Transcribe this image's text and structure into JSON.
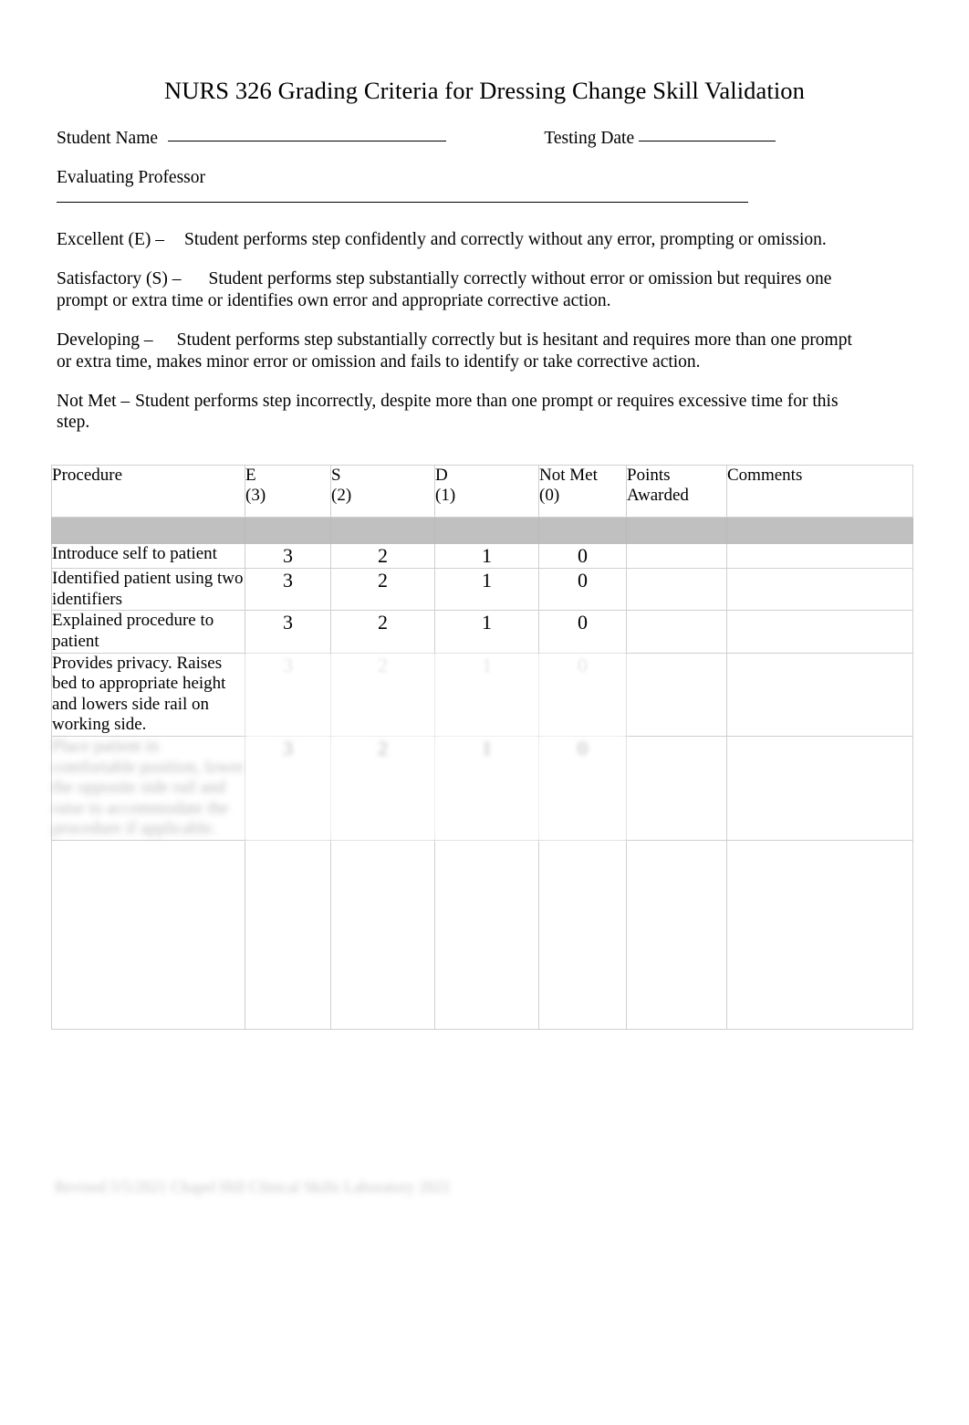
{
  "document": {
    "title": "NURS 326 Grading Criteria for Dressing Change Skill Validation"
  },
  "form": {
    "student_name_label": "Student Name",
    "testing_date_label": "Testing Date",
    "evaluating_professor_label": "Evaluating Professor",
    "student_name_value": "",
    "testing_date_value": "",
    "evaluating_professor_value": ""
  },
  "criteria": [
    {
      "term": "Excellent (E) –",
      "description": "Student performs step confidently and correctly without any error, prompting or omission."
    },
    {
      "term": "Satisfactory (S) –",
      "description": "Student performs step substantially correctly without error or omission but requires one prompt or extra time or identifies own error and appropriate corrective action."
    },
    {
      "term": "Developing –",
      "description": "Student performs step substantially correctly but is hesitant and requires more than one prompt or extra time, makes minor error or omission and fails to identify or take corrective action."
    },
    {
      "term": "Not Met –",
      "description": "Student performs step incorrectly, despite more than one prompt or requires excessive time for this step."
    }
  ],
  "table": {
    "headers": [
      {
        "line1": "Procedure",
        "line2": "",
        "align": "left"
      },
      {
        "line1": "E",
        "line2": "(3)",
        "align": "center"
      },
      {
        "line1": "S",
        "line2": "(2)",
        "align": "center"
      },
      {
        "line1": "D",
        "line2": "(1)",
        "align": "center"
      },
      {
        "line1": "Not Met",
        "line2": "(0)",
        "align": "center"
      },
      {
        "line1": "Points",
        "line2": "Awarded",
        "align": "left"
      },
      {
        "line1": "Comments",
        "line2": "",
        "align": "left"
      }
    ],
    "band_row": {
      "note": "grey highlighted row, content illegible",
      "text": ""
    },
    "rows": [
      {
        "procedure": "Introduce self to patient",
        "e": "3",
        "s": "2",
        "d": "1",
        "not_met": "0",
        "points_awarded": "",
        "comments": "",
        "state": "normal"
      },
      {
        "procedure": "Identified patient using two identifiers",
        "e": "3",
        "s": "2",
        "d": "1",
        "not_met": "0",
        "points_awarded": "",
        "comments": "",
        "state": "normal"
      },
      {
        "procedure": "Explained procedure to patient",
        "e": "3",
        "s": "2",
        "d": "1",
        "not_met": "0",
        "points_awarded": "",
        "comments": "",
        "state": "normal"
      },
      {
        "procedure": "Provides privacy. Raises bed to appropriate height and lowers side rail on working side.",
        "e": "3",
        "s": "2",
        "d": "1",
        "not_met": "0",
        "points_awarded": "",
        "comments": "",
        "state": "faded-scores"
      },
      {
        "procedure": "Place patient in comfortable position, lower the opposite side rail and raise to accommodate the procedure if applicable.",
        "e": "3",
        "s": "2",
        "d": "1",
        "not_met": "0",
        "points_awarded": "",
        "comments": "",
        "state": "obscured"
      }
    ]
  },
  "footer": {
    "text": "Revised 5/5/2021     Chapel Hill Clinical Skills Laboratory 2021"
  }
}
